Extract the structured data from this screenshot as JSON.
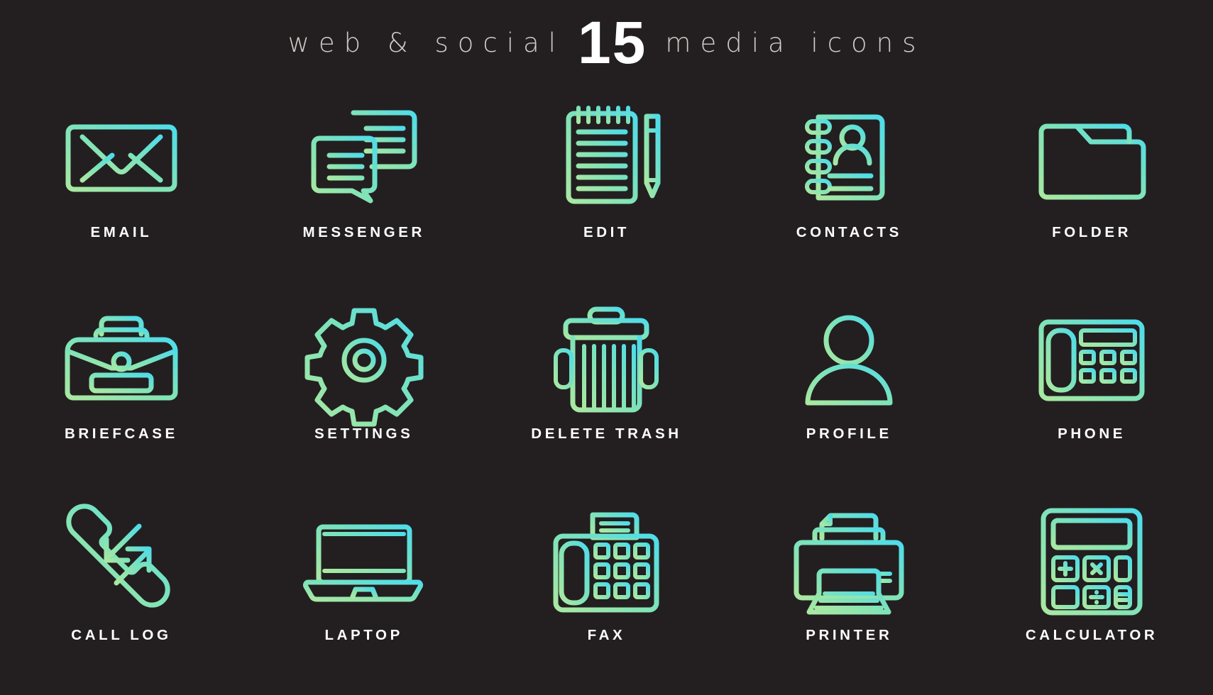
{
  "header": {
    "left_text": "web & social",
    "count": "15",
    "right_text": "media icons"
  },
  "theme": {
    "background": "#231f20",
    "label_color": "#ffffff",
    "gradient_start": "#a9e8a2",
    "gradient_mid": "#7fe3b8",
    "gradient_end": "#55dfe8"
  },
  "icons": [
    {
      "label": "EMAIL",
      "name": "email-icon"
    },
    {
      "label": "MESSENGER",
      "name": "messenger-icon"
    },
    {
      "label": "EDIT",
      "name": "edit-icon"
    },
    {
      "label": "CONTACTS",
      "name": "contacts-icon"
    },
    {
      "label": "FOLDER",
      "name": "folder-icon"
    },
    {
      "label": "BRIEFCASE",
      "name": "briefcase-icon"
    },
    {
      "label": "SETTINGS",
      "name": "settings-icon"
    },
    {
      "label": "DELETE TRASH",
      "name": "delete-trash-icon"
    },
    {
      "label": "PROFILE",
      "name": "profile-icon"
    },
    {
      "label": "PHONE",
      "name": "phone-icon"
    },
    {
      "label": "CALL LOG",
      "name": "call-log-icon"
    },
    {
      "label": "LAPTOP",
      "name": "laptop-icon"
    },
    {
      "label": "FAX",
      "name": "fax-icon"
    },
    {
      "label": "PRINTER",
      "name": "printer-icon"
    },
    {
      "label": "CALCULATOR",
      "name": "calculator-icon"
    }
  ]
}
